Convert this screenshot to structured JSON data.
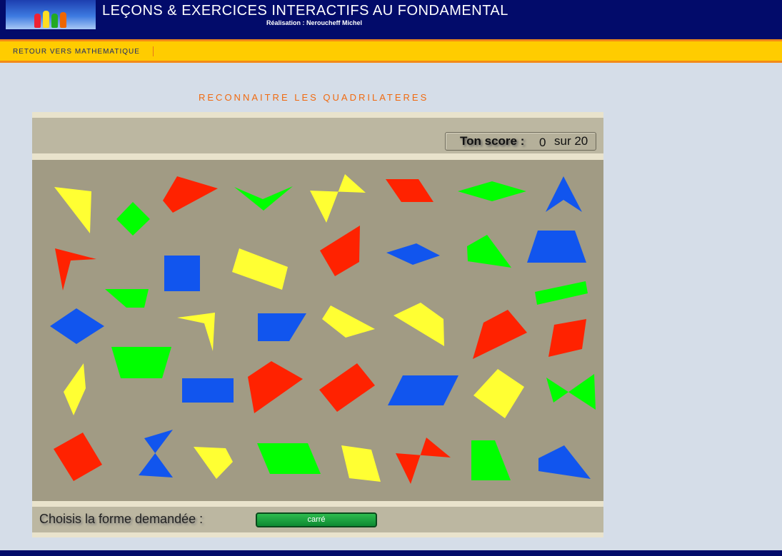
{
  "header": {
    "title": "LEÇONS & EXERCICES INTERACTIFS AU FONDAMENTAL",
    "subtitle": "Réalisation : Neroucheff Michel",
    "logo_icon": "children-logo"
  },
  "nav": {
    "back_link": "RETOUR VERS MATHEMATIQUE"
  },
  "exercise": {
    "title": "RECONNAITRE LES QUADRILATERES"
  },
  "score": {
    "label": "Ton score :",
    "value": "0",
    "total": "sur 20"
  },
  "prompt": {
    "label": "Choisis la forme demandée :",
    "answer": "carré"
  },
  "colors": {
    "yellow": "#ffff33",
    "green": "#00ff00",
    "red": "#ff2200",
    "blue": "#1155ee",
    "board": "#a19b84"
  },
  "shapes": [
    {
      "id": "s1",
      "color": "yellow",
      "type": "quadrilateral"
    },
    {
      "id": "s2",
      "color": "green",
      "type": "square"
    },
    {
      "id": "s3",
      "color": "red",
      "type": "quadrilateral"
    },
    {
      "id": "s4",
      "color": "green",
      "type": "concave"
    },
    {
      "id": "s5",
      "color": "yellow",
      "type": "crossed"
    },
    {
      "id": "s6",
      "color": "red",
      "type": "parallelogram"
    },
    {
      "id": "s7",
      "color": "green",
      "type": "rhombus"
    },
    {
      "id": "s8",
      "color": "blue",
      "type": "concave"
    },
    {
      "id": "s9",
      "color": "red",
      "type": "concave"
    },
    {
      "id": "s10",
      "color": "blue",
      "type": "square"
    },
    {
      "id": "s11",
      "color": "yellow",
      "type": "rectangle"
    },
    {
      "id": "s12",
      "color": "red",
      "type": "quadrilateral"
    },
    {
      "id": "s13",
      "color": "blue",
      "type": "rhombus"
    },
    {
      "id": "s14",
      "color": "green",
      "type": "quadrilateral"
    },
    {
      "id": "s15",
      "color": "blue",
      "type": "trapezoid"
    },
    {
      "id": "s16",
      "color": "green",
      "type": "trapezoid"
    },
    {
      "id": "s17",
      "color": "green",
      "type": "rectangle"
    },
    {
      "id": "s18",
      "color": "blue",
      "type": "rhombus"
    },
    {
      "id": "s19",
      "color": "yellow",
      "type": "concave"
    },
    {
      "id": "s20",
      "color": "blue",
      "type": "trapezoid"
    },
    {
      "id": "s21",
      "color": "yellow",
      "type": "quadrilateral"
    },
    {
      "id": "s22",
      "color": "yellow",
      "type": "quadrilateral"
    },
    {
      "id": "s23",
      "color": "red",
      "type": "quadrilateral"
    },
    {
      "id": "s24",
      "color": "red",
      "type": "rhombus"
    },
    {
      "id": "s25",
      "color": "yellow",
      "type": "rhombus"
    },
    {
      "id": "s26",
      "color": "green",
      "type": "trapezoid"
    },
    {
      "id": "s27",
      "color": "blue",
      "type": "rectangle"
    },
    {
      "id": "s28",
      "color": "red",
      "type": "quadrilateral"
    },
    {
      "id": "s29",
      "color": "red",
      "type": "rectangle"
    },
    {
      "id": "s30",
      "color": "blue",
      "type": "parallelogram"
    },
    {
      "id": "s31",
      "color": "yellow",
      "type": "square"
    },
    {
      "id": "s32",
      "color": "green",
      "type": "crossed"
    },
    {
      "id": "s33",
      "color": "red",
      "type": "square"
    },
    {
      "id": "s34",
      "color": "blue",
      "type": "crossed"
    },
    {
      "id": "s35",
      "color": "yellow",
      "type": "quadrilateral"
    },
    {
      "id": "s36",
      "color": "green",
      "type": "parallelogram"
    },
    {
      "id": "s37",
      "color": "yellow",
      "type": "quadrilateral"
    },
    {
      "id": "s38",
      "color": "red",
      "type": "crossed"
    },
    {
      "id": "s39",
      "color": "green",
      "type": "trapezoid"
    },
    {
      "id": "s40",
      "color": "blue",
      "type": "quadrilateral"
    }
  ]
}
